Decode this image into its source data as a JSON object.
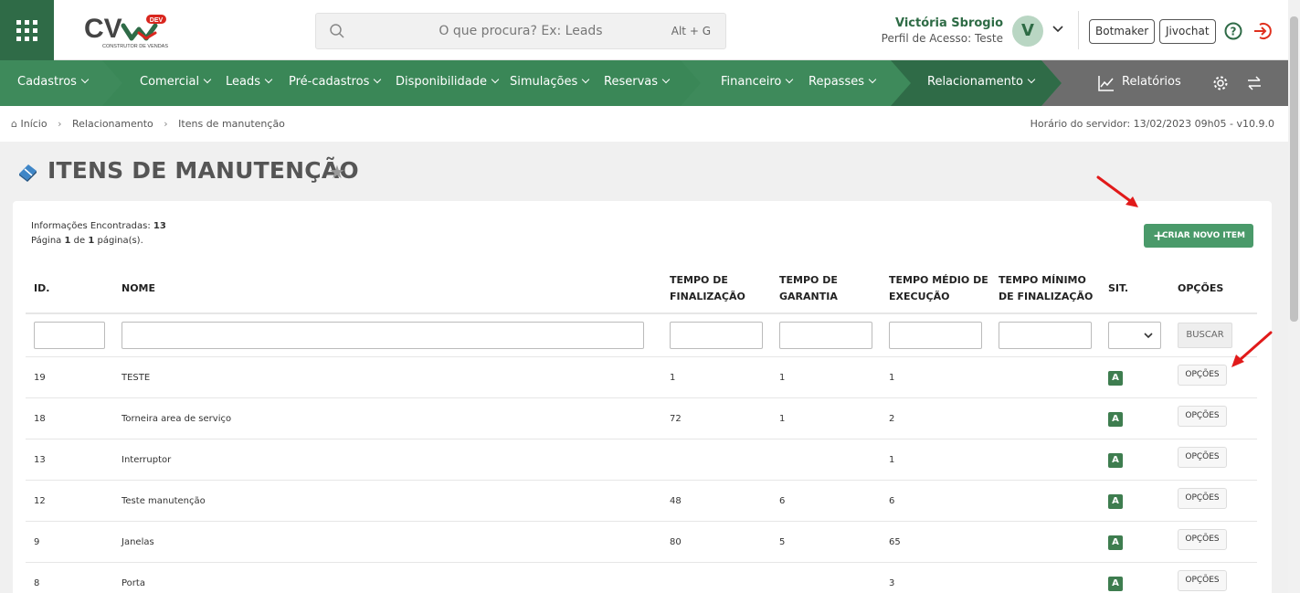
{
  "header": {
    "logo_text": "CV",
    "logo_badge": "DEV",
    "logo_sub": "CONSTRUTOR DE VENDAS",
    "search_placeholder": "O que procura? Ex: Leads",
    "search_shortcut": "Alt + G",
    "user_name": "Victória Sbrogio",
    "user_profile": "Perfil de Acesso: Teste",
    "avatar_letter": "V",
    "btn_botmaker": "Botmaker",
    "btn_jivochat": "Jivochat"
  },
  "nav": {
    "items": [
      "Cadastros",
      "Comercial",
      "Leads",
      "Pré-cadastros",
      "Disponibilidade",
      "Simulações",
      "Reservas",
      "Financeiro",
      "Repasses",
      "Relacionamento"
    ],
    "reports": "Relatórios"
  },
  "breadcrumb": {
    "home": "Início",
    "items": [
      "Relacionamento",
      "Itens de manutenção"
    ],
    "server_time": "Horário do servidor: 13/02/2023 09h05 - v10.9.0"
  },
  "page": {
    "title": "ITENS DE MANUTENÇÃO",
    "info_label": "Informações Encontradas:",
    "info_count": "13",
    "page_word": "Página",
    "page_current": "1",
    "page_of": "de",
    "page_total": "1",
    "page_suffix": "página(s).",
    "new_button": "CRIAR NOVO ITEM"
  },
  "table": {
    "columns": {
      "id": "ID.",
      "nome": "NOME",
      "tempo_finalizacao_1": "TEMPO DE",
      "tempo_finalizacao_2": "FINALIZAÇÃO",
      "tempo_garantia_1": "TEMPO DE",
      "tempo_garantia_2": "GARANTIA",
      "tempo_medio_1": "TEMPO MÉDIO DE",
      "tempo_medio_2": "EXECUÇÃO",
      "tempo_minimo_1": "TEMPO MÍNIMO",
      "tempo_minimo_2": "DE FINALIZAÇÃO",
      "sit": "SIT.",
      "opcoes": "OPÇÕES"
    },
    "search_button": "BUSCAR",
    "options_label": "OPÇÕES",
    "rows": [
      {
        "id": "19",
        "nome": "TESTE",
        "finalizacao": "1",
        "garantia": "1",
        "medio": "1",
        "minimo": "",
        "sit": "A"
      },
      {
        "id": "18",
        "nome": "Torneira area de serviço",
        "finalizacao": "72",
        "garantia": "1",
        "medio": "2",
        "minimo": "",
        "sit": "A"
      },
      {
        "id": "13",
        "nome": "Interruptor",
        "finalizacao": "",
        "garantia": "",
        "medio": "1",
        "minimo": "",
        "sit": "A"
      },
      {
        "id": "12",
        "nome": "Teste manutenção",
        "finalizacao": "48",
        "garantia": "6",
        "medio": "6",
        "minimo": "",
        "sit": "A"
      },
      {
        "id": "9",
        "nome": "Janelas",
        "finalizacao": "80",
        "garantia": "5",
        "medio": "65",
        "minimo": "",
        "sit": "A"
      },
      {
        "id": "8",
        "nome": "Porta",
        "finalizacao": "",
        "garantia": "",
        "medio": "3",
        "minimo": "",
        "sit": "A"
      }
    ]
  },
  "colors": {
    "brand_dark": "#2f6b47",
    "nav_green": "#3e8a5b",
    "nav_dark": "#2f6b47",
    "nav_gray": "#6d6d6d",
    "accent_red": "#e0301e"
  }
}
